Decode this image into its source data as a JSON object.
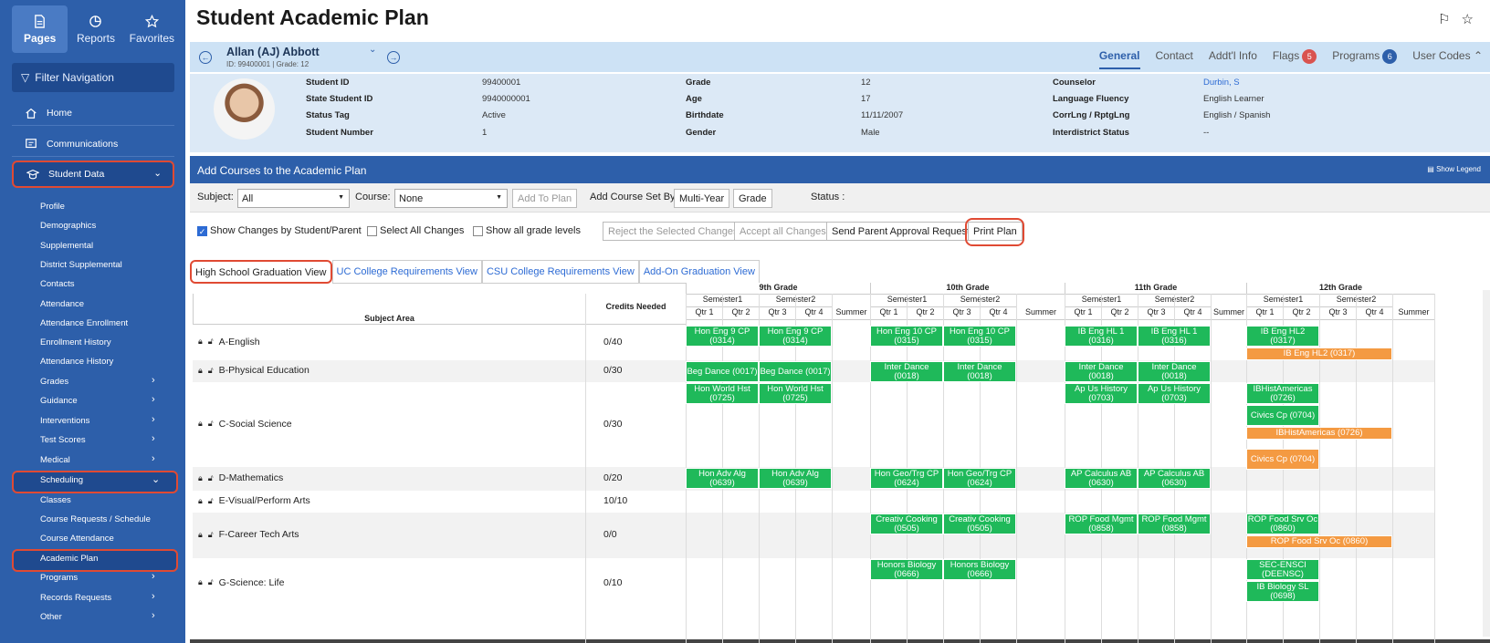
{
  "sidebar": {
    "tabs": [
      {
        "label": "Pages",
        "icon": "document-icon"
      },
      {
        "label": "Reports",
        "icon": "pie-chart-icon"
      },
      {
        "label": "Favorites",
        "icon": "star-icon"
      }
    ],
    "filter_label": "Filter Navigation",
    "items": [
      {
        "label": "Home",
        "icon": "home-icon"
      },
      {
        "label": "Communications",
        "icon": "chat-icon"
      },
      {
        "label": "Student Data",
        "icon": "graduation-cap-icon"
      }
    ],
    "student_data_subitems": [
      "Profile",
      "Demographics",
      "Supplemental",
      "District Supplemental",
      "Contacts",
      "Attendance",
      "Attendance Enrollment",
      "Enrollment History",
      "Attendance History",
      "Grades",
      "Guidance",
      "Interventions",
      "Test Scores",
      "Medical",
      "Scheduling",
      "Classes",
      "Course Requests / Schedule",
      "Course Attendance",
      "Academic Plan",
      "Programs",
      "Records Requests",
      "Other"
    ]
  },
  "page": {
    "title": "Student Academic Plan"
  },
  "student": {
    "name": "Allan (AJ) Abbott",
    "id_line": "ID: 99400001 | Grade: 12"
  },
  "header_tabs": [
    {
      "label": "General"
    },
    {
      "label": "Contact"
    },
    {
      "label": "Addt'l Info"
    },
    {
      "label": "Flags",
      "badge": "5",
      "badge_color": "#d9534f"
    },
    {
      "label": "Programs",
      "badge": "6",
      "badge_color": "#2d5faa"
    },
    {
      "label": "User Codes"
    }
  ],
  "info": {
    "col1": [
      [
        "Student ID",
        "99400001"
      ],
      [
        "State Student ID",
        "9940000001"
      ],
      [
        "Status Tag",
        "Active"
      ],
      [
        "Student Number",
        "1"
      ]
    ],
    "col2": [
      [
        "Grade",
        "12"
      ],
      [
        "Age",
        "17"
      ],
      [
        "Birthdate",
        "11/11/2007"
      ],
      [
        "Gender",
        "Male"
      ]
    ],
    "col3": [
      [
        "Counselor",
        "Durbin, S"
      ],
      [
        "Language Fluency",
        "English Learner"
      ],
      [
        "CorrLng / RptgLng",
        "English / Spanish"
      ],
      [
        "Interdistrict Status",
        "--"
      ]
    ]
  },
  "section": {
    "title": "Add Courses to the Academic Plan",
    "legend": "Show Legend"
  },
  "controls": {
    "subject_label": "Subject:",
    "subject_value": "All",
    "course_label": "Course:",
    "course_value": "None",
    "add_to_plan": "Add To Plan",
    "course_set_label": "Add Course Set By:",
    "multi_year": "Multi-Year",
    "grade": "Grade",
    "status_label": "Status :",
    "show_changes": "Show Changes by Student/Parent",
    "select_all": "Select All Changes",
    "show_all_grades": "Show all grade levels",
    "reject": "Reject the Selected Changes",
    "accept": "Accept all Changes",
    "send_parent": "Send Parent Approval Request",
    "print": "Print Plan"
  },
  "view_tabs": [
    "High School Graduation View",
    "UC College Requirements View",
    "CSU College Requirements View",
    "Add-On Graduation View"
  ],
  "grid": {
    "subject_header": "Subject Area",
    "credits_header": "Credits Needed",
    "grades": [
      "9th Grade",
      "10th Grade",
      "11th Grade",
      "12th Grade"
    ],
    "semesters": [
      "Semester1",
      "Semester2"
    ],
    "quarters": [
      "Qtr 1",
      "Qtr 2",
      "Qtr 3",
      "Qtr 4"
    ],
    "summer": "Summer",
    "rows": [
      {
        "subject": "A-English",
        "credits": "0/40"
      },
      {
        "subject": "B-Physical Education",
        "credits": "0/30"
      },
      {
        "subject": "C-Social Science",
        "credits": "0/30"
      },
      {
        "subject": "D-Mathematics",
        "credits": "0/20"
      },
      {
        "subject": "E-Visual/Perform Arts",
        "credits": "10/10"
      },
      {
        "subject": "F-Career Tech Arts",
        "credits": "0/0"
      },
      {
        "subject": "G-Science: Life",
        "credits": "0/10"
      }
    ],
    "courses": [
      {
        "row": 0,
        "grade": 0,
        "sem": 0,
        "line": 0,
        "text": "Hon Eng 9 CP (0314)",
        "color": "green"
      },
      {
        "row": 0,
        "grade": 0,
        "sem": 1,
        "line": 0,
        "text": "Hon Eng 9 CP (0314)",
        "color": "green"
      },
      {
        "row": 0,
        "grade": 1,
        "sem": 0,
        "line": 0,
        "text": "Hon Eng 10 CP (0315)",
        "color": "green"
      },
      {
        "row": 0,
        "grade": 1,
        "sem": 1,
        "line": 0,
        "text": "Hon Eng 10 CP (0315)",
        "color": "green"
      },
      {
        "row": 0,
        "grade": 2,
        "sem": 0,
        "line": 0,
        "text": "IB Eng HL 1 (0316)",
        "color": "green"
      },
      {
        "row": 0,
        "grade": 2,
        "sem": 1,
        "line": 0,
        "text": "IB Eng HL 1 (0316)",
        "color": "green"
      },
      {
        "row": 0,
        "grade": 3,
        "sem": 0,
        "line": 0,
        "text": "IB Eng HL2 (0317)",
        "color": "green"
      },
      {
        "row": 0,
        "grade": 3,
        "sem": "year",
        "line": 1,
        "text": "IB Eng HL2 (0317)",
        "color": "orange"
      },
      {
        "row": 1,
        "grade": 0,
        "sem": 0,
        "line": 0,
        "text": "Beg Dance (0017)",
        "color": "green"
      },
      {
        "row": 1,
        "grade": 0,
        "sem": 1,
        "line": 0,
        "text": "Beg Dance (0017)",
        "color": "green"
      },
      {
        "row": 1,
        "grade": 1,
        "sem": 0,
        "line": 0,
        "text": "Inter Dance (0018)",
        "color": "green"
      },
      {
        "row": 1,
        "grade": 1,
        "sem": 1,
        "line": 0,
        "text": "Inter Dance (0018)",
        "color": "green"
      },
      {
        "row": 1,
        "grade": 2,
        "sem": 0,
        "line": 0,
        "text": "Inter Dance (0018)",
        "color": "green"
      },
      {
        "row": 1,
        "grade": 2,
        "sem": 1,
        "line": 0,
        "text": "Inter Dance (0018)",
        "color": "green"
      },
      {
        "row": 2,
        "grade": 0,
        "sem": 0,
        "line": 0,
        "text": "Hon World Hst (0725)",
        "color": "green"
      },
      {
        "row": 2,
        "grade": 0,
        "sem": 1,
        "line": 0,
        "text": "Hon World Hst (0725)",
        "color": "green"
      },
      {
        "row": 2,
        "grade": 2,
        "sem": 0,
        "line": 0,
        "text": "Ap Us History (0703)",
        "color": "green"
      },
      {
        "row": 2,
        "grade": 2,
        "sem": 1,
        "line": 0,
        "text": "Ap Us History (0703)",
        "color": "green"
      },
      {
        "row": 2,
        "grade": 3,
        "sem": 0,
        "line": 0,
        "text": "IBHistAmericas (0726)",
        "color": "green"
      },
      {
        "row": 2,
        "grade": 3,
        "sem": 0,
        "line": 1,
        "text": "Civics Cp (0704)",
        "color": "green"
      },
      {
        "row": 2,
        "grade": 3,
        "sem": "year",
        "line": 2,
        "text": "IBHistAmericas (0726)",
        "color": "orange"
      },
      {
        "row": 2,
        "grade": 3,
        "sem": 0,
        "line": 3,
        "text": "Civics Cp (0704)",
        "color": "orange"
      },
      {
        "row": 3,
        "grade": 0,
        "sem": 0,
        "line": 0,
        "text": "Hon Adv Alg (0639)",
        "color": "green"
      },
      {
        "row": 3,
        "grade": 0,
        "sem": 1,
        "line": 0,
        "text": "Hon Adv Alg (0639)",
        "color": "green"
      },
      {
        "row": 3,
        "grade": 1,
        "sem": 0,
        "line": 0,
        "text": "Hon Geo/Trg CP (0624)",
        "color": "green"
      },
      {
        "row": 3,
        "grade": 1,
        "sem": 1,
        "line": 0,
        "text": "Hon Geo/Trg CP (0624)",
        "color": "green"
      },
      {
        "row": 3,
        "grade": 2,
        "sem": 0,
        "line": 0,
        "text": "AP Calculus AB (0630)",
        "color": "green"
      },
      {
        "row": 3,
        "grade": 2,
        "sem": 1,
        "line": 0,
        "text": "AP Calculus AB (0630)",
        "color": "green"
      },
      {
        "row": 5,
        "grade": 1,
        "sem": 0,
        "line": 0,
        "text": "Creativ Cooking (0505)",
        "color": "green"
      },
      {
        "row": 5,
        "grade": 1,
        "sem": 1,
        "line": 0,
        "text": "Creativ Cooking (0505)",
        "color": "green"
      },
      {
        "row": 5,
        "grade": 2,
        "sem": 0,
        "line": 0,
        "text": "ROP Food Mgmt (0858)",
        "color": "green"
      },
      {
        "row": 5,
        "grade": 2,
        "sem": 1,
        "line": 0,
        "text": "ROP Food Mgmt (0858)",
        "color": "green"
      },
      {
        "row": 5,
        "grade": 3,
        "sem": 0,
        "line": 0,
        "text": "ROP Food Srv Oc (0860)",
        "color": "green"
      },
      {
        "row": 5,
        "grade": 3,
        "sem": "year",
        "line": 1,
        "text": "ROP Food Srv Oc (0860)",
        "color": "orange"
      },
      {
        "row": 6,
        "grade": 1,
        "sem": 0,
        "line": 0,
        "text": "Honors Biology (0666)",
        "color": "green"
      },
      {
        "row": 6,
        "grade": 1,
        "sem": 1,
        "line": 0,
        "text": "Honors Biology (0666)",
        "color": "green"
      },
      {
        "row": 6,
        "grade": 3,
        "sem": 0,
        "line": 0,
        "text": "SEC-ENSCI (DEENSC)",
        "color": "green"
      },
      {
        "row": 6,
        "grade": 3,
        "sem": 0,
        "line": 1,
        "text": "IB Biology SL (0698)",
        "color": "green"
      }
    ]
  },
  "colors": {
    "green": "#1fb95a",
    "orange": "#f49a42",
    "accent": "#2d5faa",
    "highlight": "#e04a33"
  }
}
